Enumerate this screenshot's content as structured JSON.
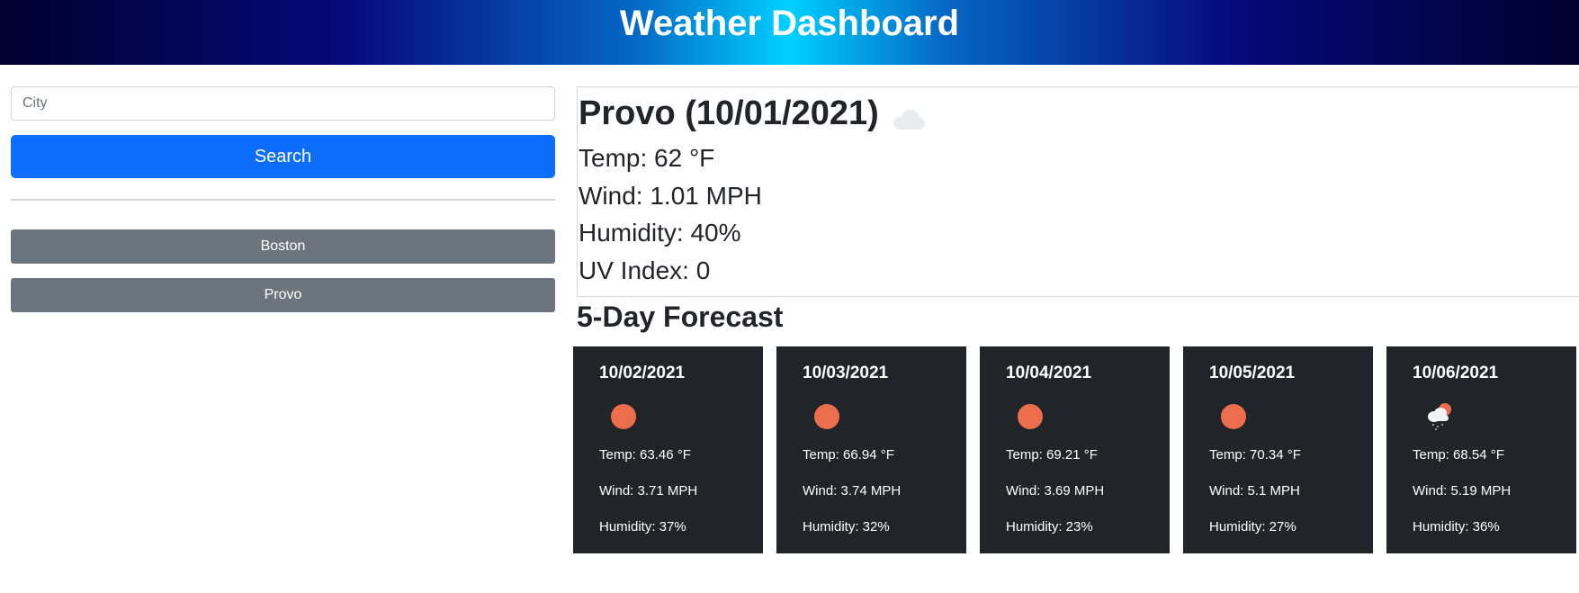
{
  "header": {
    "title": "Weather Dashboard"
  },
  "search": {
    "placeholder": "City",
    "value": "",
    "button_label": "Search"
  },
  "history": [
    {
      "label": "Boston"
    },
    {
      "label": "Provo"
    }
  ],
  "current": {
    "title": "Provo (10/01/2021)",
    "icon": "cloud-icon",
    "temp": "Temp: 62 °F",
    "wind": "Wind: 1.01 MPH",
    "humidity": "Humidity: 40%",
    "uv": "UV Index: 0"
  },
  "forecast": {
    "title": "5-Day Forecast",
    "days": [
      {
        "date": "10/02/2021",
        "icon": "sun-icon",
        "temp": "Temp: 63.46 °F",
        "wind": "Wind: 3.71 MPH",
        "humidity": "Humidity: 37%"
      },
      {
        "date": "10/03/2021",
        "icon": "sun-icon",
        "temp": "Temp: 66.94 °F",
        "wind": "Wind: 3.74 MPH",
        "humidity": "Humidity: 32%"
      },
      {
        "date": "10/04/2021",
        "icon": "sun-icon",
        "temp": "Temp: 69.21 °F",
        "wind": "Wind: 3.69 MPH",
        "humidity": "Humidity: 23%"
      },
      {
        "date": "10/05/2021",
        "icon": "sun-icon",
        "temp": "Temp: 70.34 °F",
        "wind": "Wind: 5.1 MPH",
        "humidity": "Humidity: 27%"
      },
      {
        "date": "10/06/2021",
        "icon": "rain-cloud-sun-icon",
        "temp": "Temp: 68.54 °F",
        "wind": "Wind: 5.19 MPH",
        "humidity": "Humidity: 36%"
      }
    ]
  },
  "colors": {
    "primary": "#0d6efd",
    "secondary": "#6c757d",
    "card_bg": "#212529",
    "sun": "#ec6e4c"
  }
}
